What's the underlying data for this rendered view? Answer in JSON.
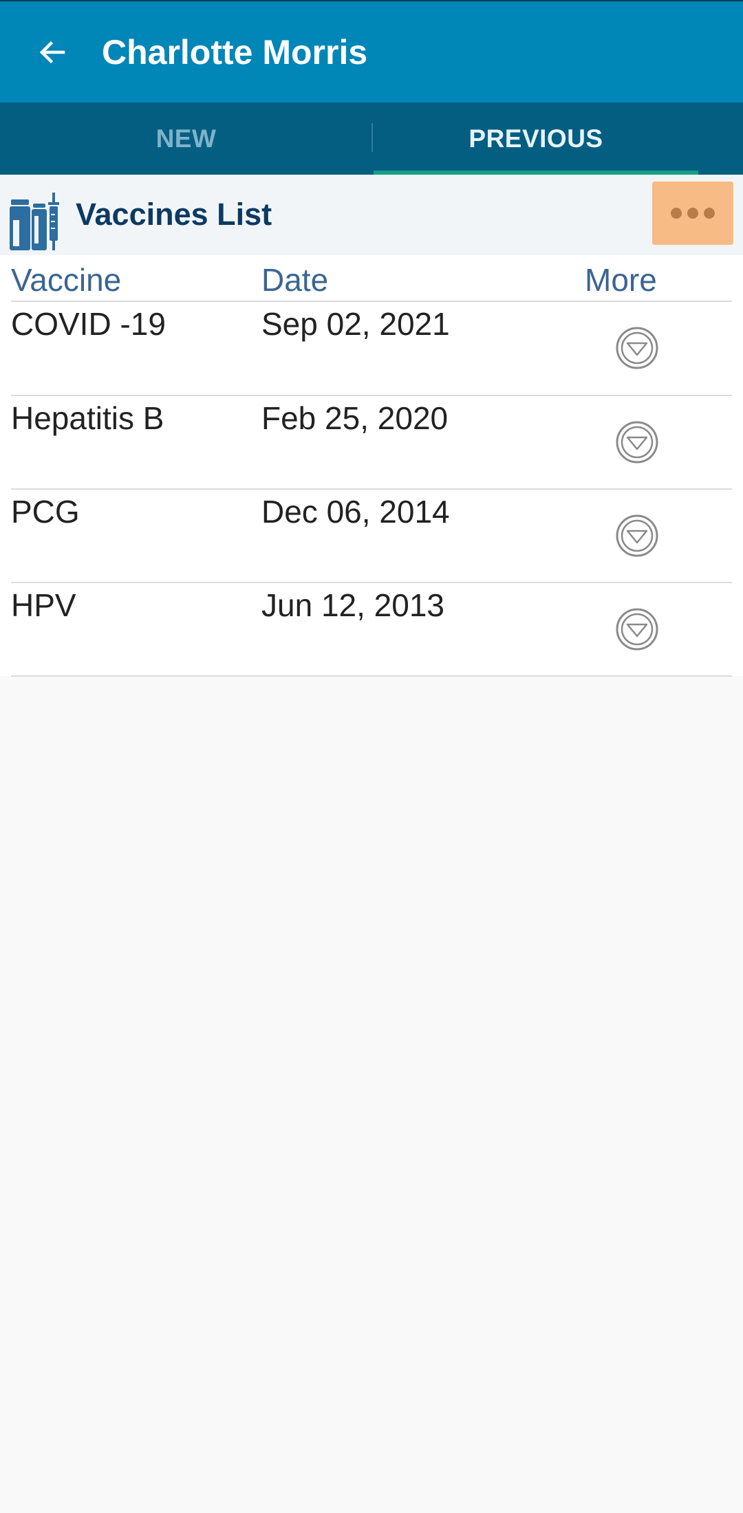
{
  "app_bar": {
    "back_icon": "arrow-left-icon",
    "title": "Charlotte Morris",
    "color": "#0186b8"
  },
  "tabs": [
    {
      "label": "NEW",
      "selected": false
    },
    {
      "label": "PREVIOUS",
      "selected": true
    }
  ],
  "section": {
    "icon": "vaccine-vials-icon",
    "title": "Vaccines List",
    "menu_icon": "more-horizontal-icon"
  },
  "table": {
    "headers": {
      "vaccine": "Vaccine",
      "date": "Date",
      "more": "More"
    },
    "rows": [
      {
        "vaccine": "COVID -19",
        "date": "Sep 02, 2021",
        "more_icon": "chevron-down-circle-icon"
      },
      {
        "vaccine": "Hepatitis B",
        "date": "Feb 25, 2020",
        "more_icon": "chevron-down-circle-icon"
      },
      {
        "vaccine": "PCG",
        "date": "Dec 06, 2014",
        "more_icon": "chevron-down-circle-icon"
      },
      {
        "vaccine": "HPV",
        "date": "Jun 12, 2013",
        "more_icon": "chevron-down-circle-icon"
      }
    ]
  },
  "colors": {
    "accent": "#0186b8",
    "tab_bar": "#045e82",
    "tab_indicator": "#16a085",
    "section_title": "#0d3a63",
    "menu_button": "#f7bb86"
  }
}
